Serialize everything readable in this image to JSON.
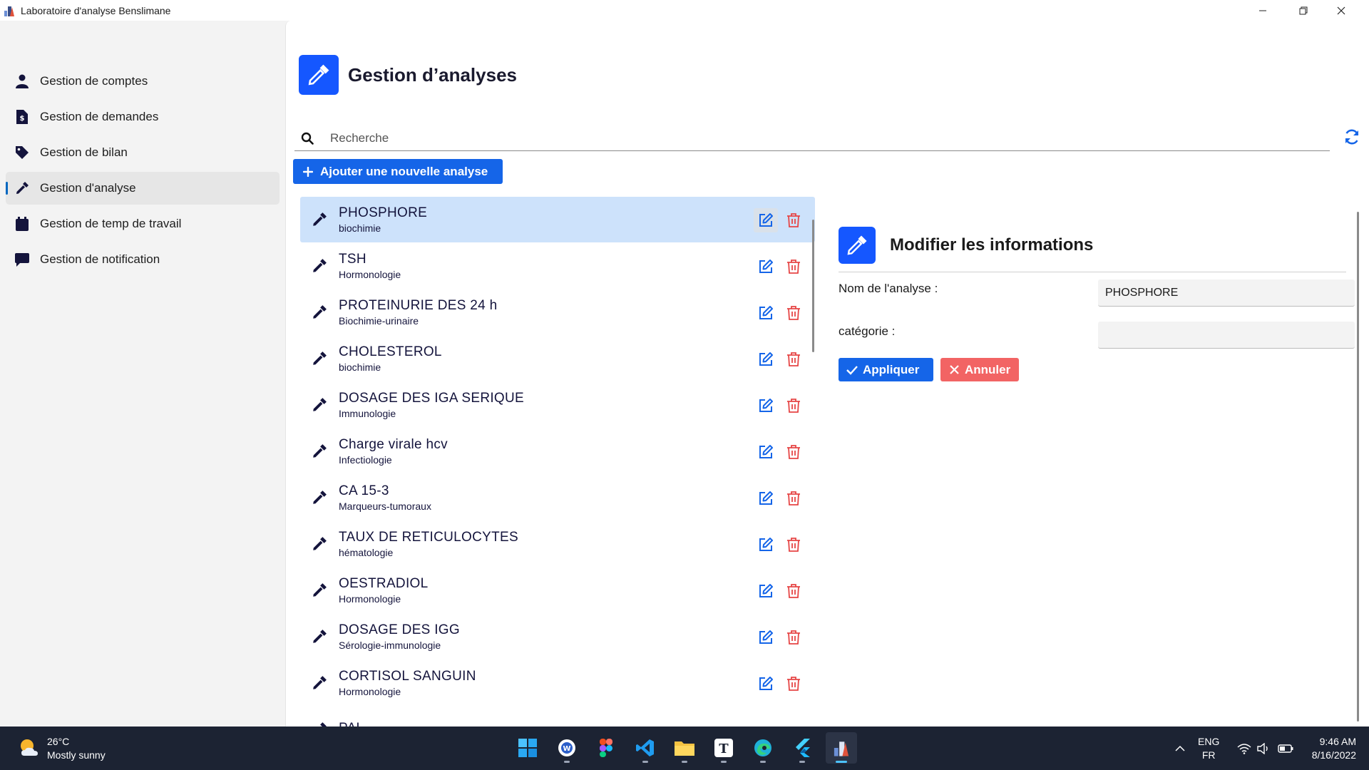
{
  "window": {
    "title": "Laboratoire d'analyse Benslimane"
  },
  "sidebar": {
    "items": [
      {
        "label": "Gestion de comptes",
        "icon": "user-icon"
      },
      {
        "label": "Gestion de demandes",
        "icon": "invoice-dollar-icon"
      },
      {
        "label": "Gestion de bilan",
        "icon": "tag-icon"
      },
      {
        "label": "Gestion d'analyse",
        "icon": "pipette-icon",
        "active": true
      },
      {
        "label": "Gestion de temp de travail",
        "icon": "calendar-icon"
      },
      {
        "label": "Gestion de notification",
        "icon": "comment-icon"
      }
    ]
  },
  "main": {
    "title": "Gestion d’analyses",
    "search_placeholder": "Recherche",
    "add_button": "Ajouter  une nouvelle analyse",
    "analyses": [
      {
        "name": "PHOSPHORE",
        "category": "biochimie",
        "selected": true
      },
      {
        "name": "TSH",
        "category": "Hormonologie"
      },
      {
        "name": "PROTEINURIE DES 24 h",
        "category": "Biochimie-urinaire"
      },
      {
        "name": "CHOLESTEROL",
        "category": "biochimie"
      },
      {
        "name": "DOSAGE DES IGA SERIQUE",
        "category": "Immunologie"
      },
      {
        "name": "Charge virale hcv",
        "category": "Infectiologie"
      },
      {
        "name": "CA 15-3",
        "category": "Marqueurs-tumoraux"
      },
      {
        "name": "TAUX DE RETICULOCYTES",
        "category": "hématologie"
      },
      {
        "name": "OESTRADIOL",
        "category": "Hormonologie"
      },
      {
        "name": "DOSAGE DES IGG",
        "category": "Sérologie-immunologie"
      },
      {
        "name": "CORTISOL SANGUIN",
        "category": "Hormonologie"
      },
      {
        "name": "PAL",
        "category": ""
      }
    ]
  },
  "edit_panel": {
    "title": "Modifier les informations",
    "name_label": "Nom de l'analyse :",
    "name_value": "PHOSPHORE",
    "category_label": "catégorie :",
    "category_value": "",
    "apply_label": "Appliquer",
    "cancel_label": "Annuler"
  },
  "taskbar": {
    "weather_temp": "26°C",
    "weather_desc": "Mostly sunny",
    "lang_top": "ENG",
    "lang_bottom": "FR",
    "time": "9:46 AM",
    "date": "8/16/2022",
    "apps": [
      "start-icon",
      "wordpad-icon",
      "figma-icon",
      "vscode-icon",
      "file-explorer-icon",
      "typora-icon",
      "edge-icon",
      "flutter-icon",
      "lab-app-icon"
    ]
  },
  "colors": {
    "accent": "#1565e8",
    "danger": "#f26464",
    "selected_row": "#cde2fb",
    "icon_dark": "#14143c",
    "taskbar": "#1c2333"
  }
}
